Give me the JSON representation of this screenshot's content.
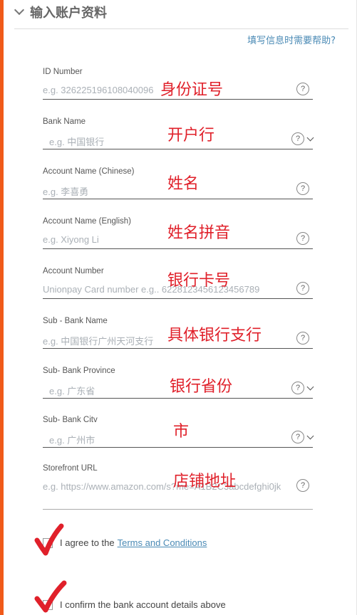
{
  "header": {
    "title": "输入账户资料",
    "help_link": "填写信息时需要帮助?"
  },
  "fields": [
    {
      "label": "ID Number",
      "placeholder": "e.g. 326225196108040096",
      "annotation": "身份证号",
      "help": "?"
    },
    {
      "label": "Bank Name",
      "placeholder": "e.g. 中国银行",
      "annotation": "开户行",
      "help": "?"
    },
    {
      "label": "Account Name (Chinese)",
      "placeholder": "e.g. 李喜勇",
      "annotation": "姓名",
      "help": "?"
    },
    {
      "label": "Account Name (English)",
      "placeholder": "e.g. Xiyong Li",
      "annotation": "姓名拼音",
      "help": "?"
    },
    {
      "label": "Account Number",
      "placeholder": "Unionpay Card number e.g.. 6228123456123456789",
      "annotation": "银行卡号",
      "help": "?"
    },
    {
      "label": "Sub - Bank Name",
      "placeholder": "e.g. 中国银行广州天河支行",
      "annotation": "具体银行支行",
      "help": "?"
    },
    {
      "label": "Sub- Bank Province",
      "placeholder": "e.g. 广东省",
      "annotation": "银行省份",
      "help": "?"
    },
    {
      "label": "Sub- Bank Citv",
      "placeholder": "e.g. 广州市",
      "annotation": "市",
      "help": "?"
    },
    {
      "label": "Storefront URL",
      "placeholder": "e.g. https://www.amazon.com/s?me=A1B2C3abcdefghi0jk",
      "annotation": "店铺地址",
      "help": "?"
    }
  ],
  "agree": {
    "text": "I agree to the",
    "link": "Terms and Conditions"
  },
  "confirm": {
    "text": "I confirm the bank account details above"
  },
  "colors": {
    "accent": "#f05a1a",
    "link": "#4a8ab5",
    "annotation": "#e0202a"
  }
}
